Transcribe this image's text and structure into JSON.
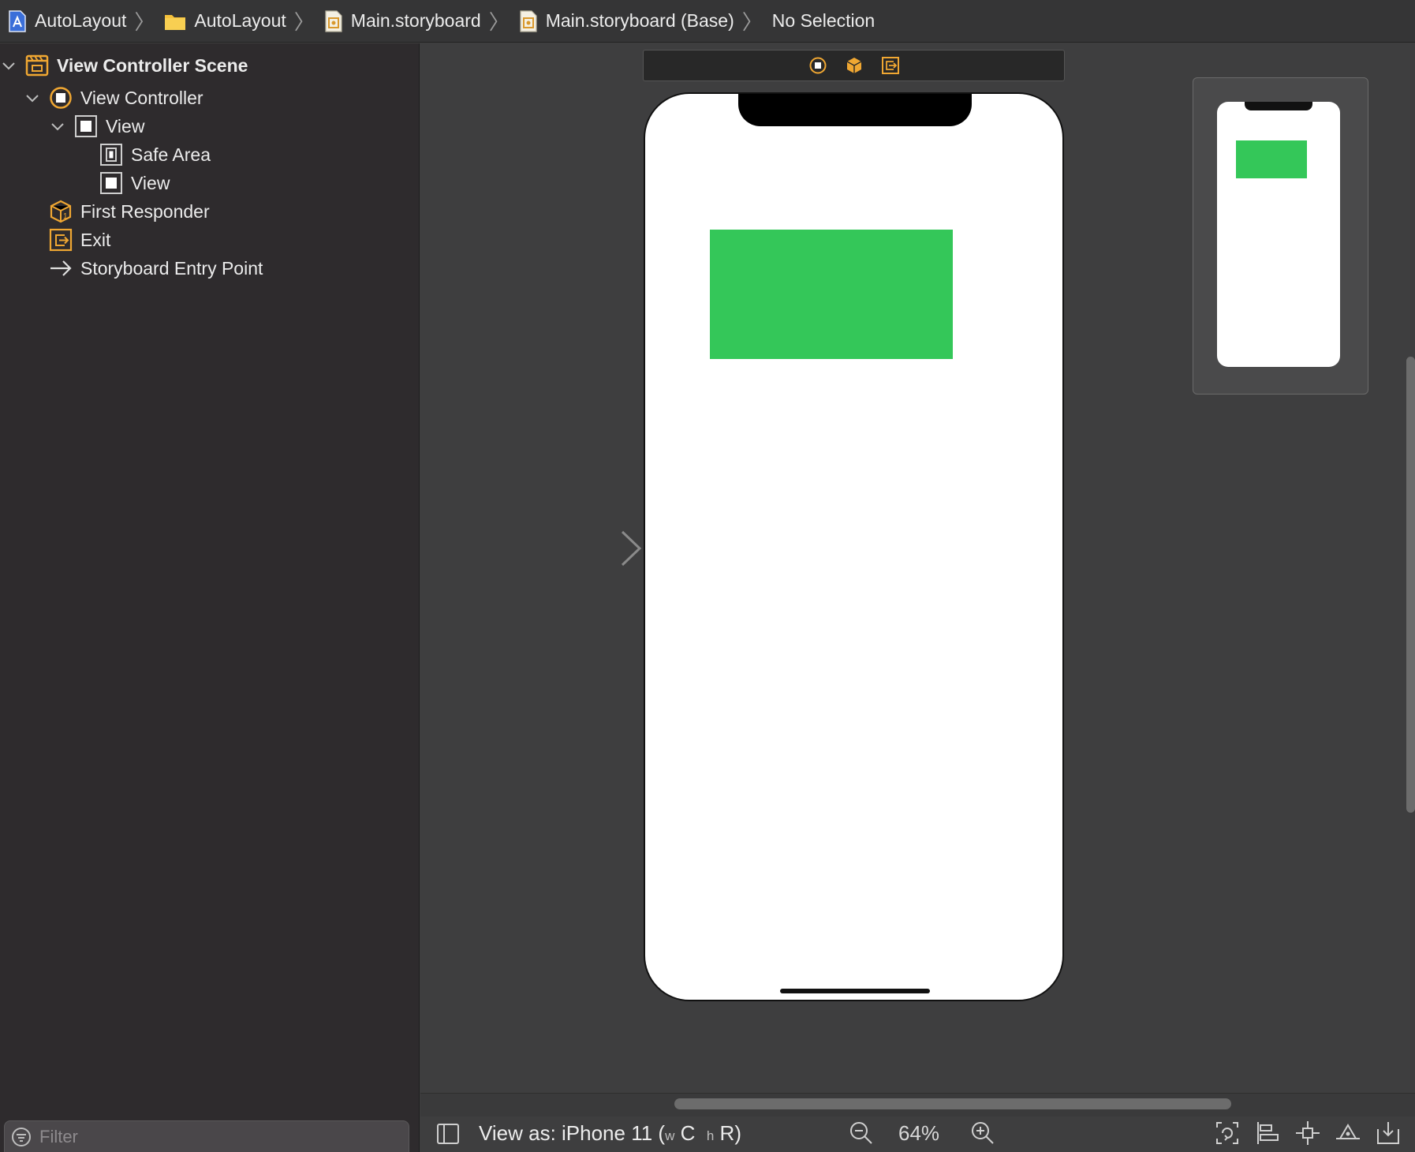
{
  "breadcrumb": {
    "items": [
      {
        "label": "AutoLayout",
        "icon": "project-file-icon"
      },
      {
        "label": "AutoLayout",
        "icon": "folder-icon"
      },
      {
        "label": "Main.storyboard",
        "icon": "storyboard-file-icon"
      },
      {
        "label": "Main.storyboard (Base)",
        "icon": "storyboard-file-icon"
      },
      {
        "label": "No Selection",
        "icon": ""
      }
    ]
  },
  "navigator": {
    "scene": {
      "label": "View Controller Scene",
      "icon": "scene-icon"
    },
    "items": [
      {
        "label": "View Controller",
        "icon": "view-controller-icon"
      },
      {
        "label": "View",
        "icon": "view-icon"
      },
      {
        "label": "Safe Area",
        "icon": "safe-area-icon"
      },
      {
        "label": "View",
        "icon": "view-icon"
      },
      {
        "label": "First Responder",
        "icon": "first-responder-icon"
      },
      {
        "label": "Exit",
        "icon": "exit-icon"
      },
      {
        "label": "Storyboard Entry Point",
        "icon": "arrow-right-icon"
      }
    ],
    "filter_placeholder": "Filter"
  },
  "canvas": {
    "subview_color": "#34c759",
    "accent_color": "#f0a732"
  },
  "bottombar": {
    "view_as_prefix": "View as: iPhone 11 (",
    "width_class_letter": "w",
    "width_class": "C",
    "height_class_letter": "h",
    "height_class": "R",
    "view_as_suffix": ")",
    "zoom": "64%"
  }
}
